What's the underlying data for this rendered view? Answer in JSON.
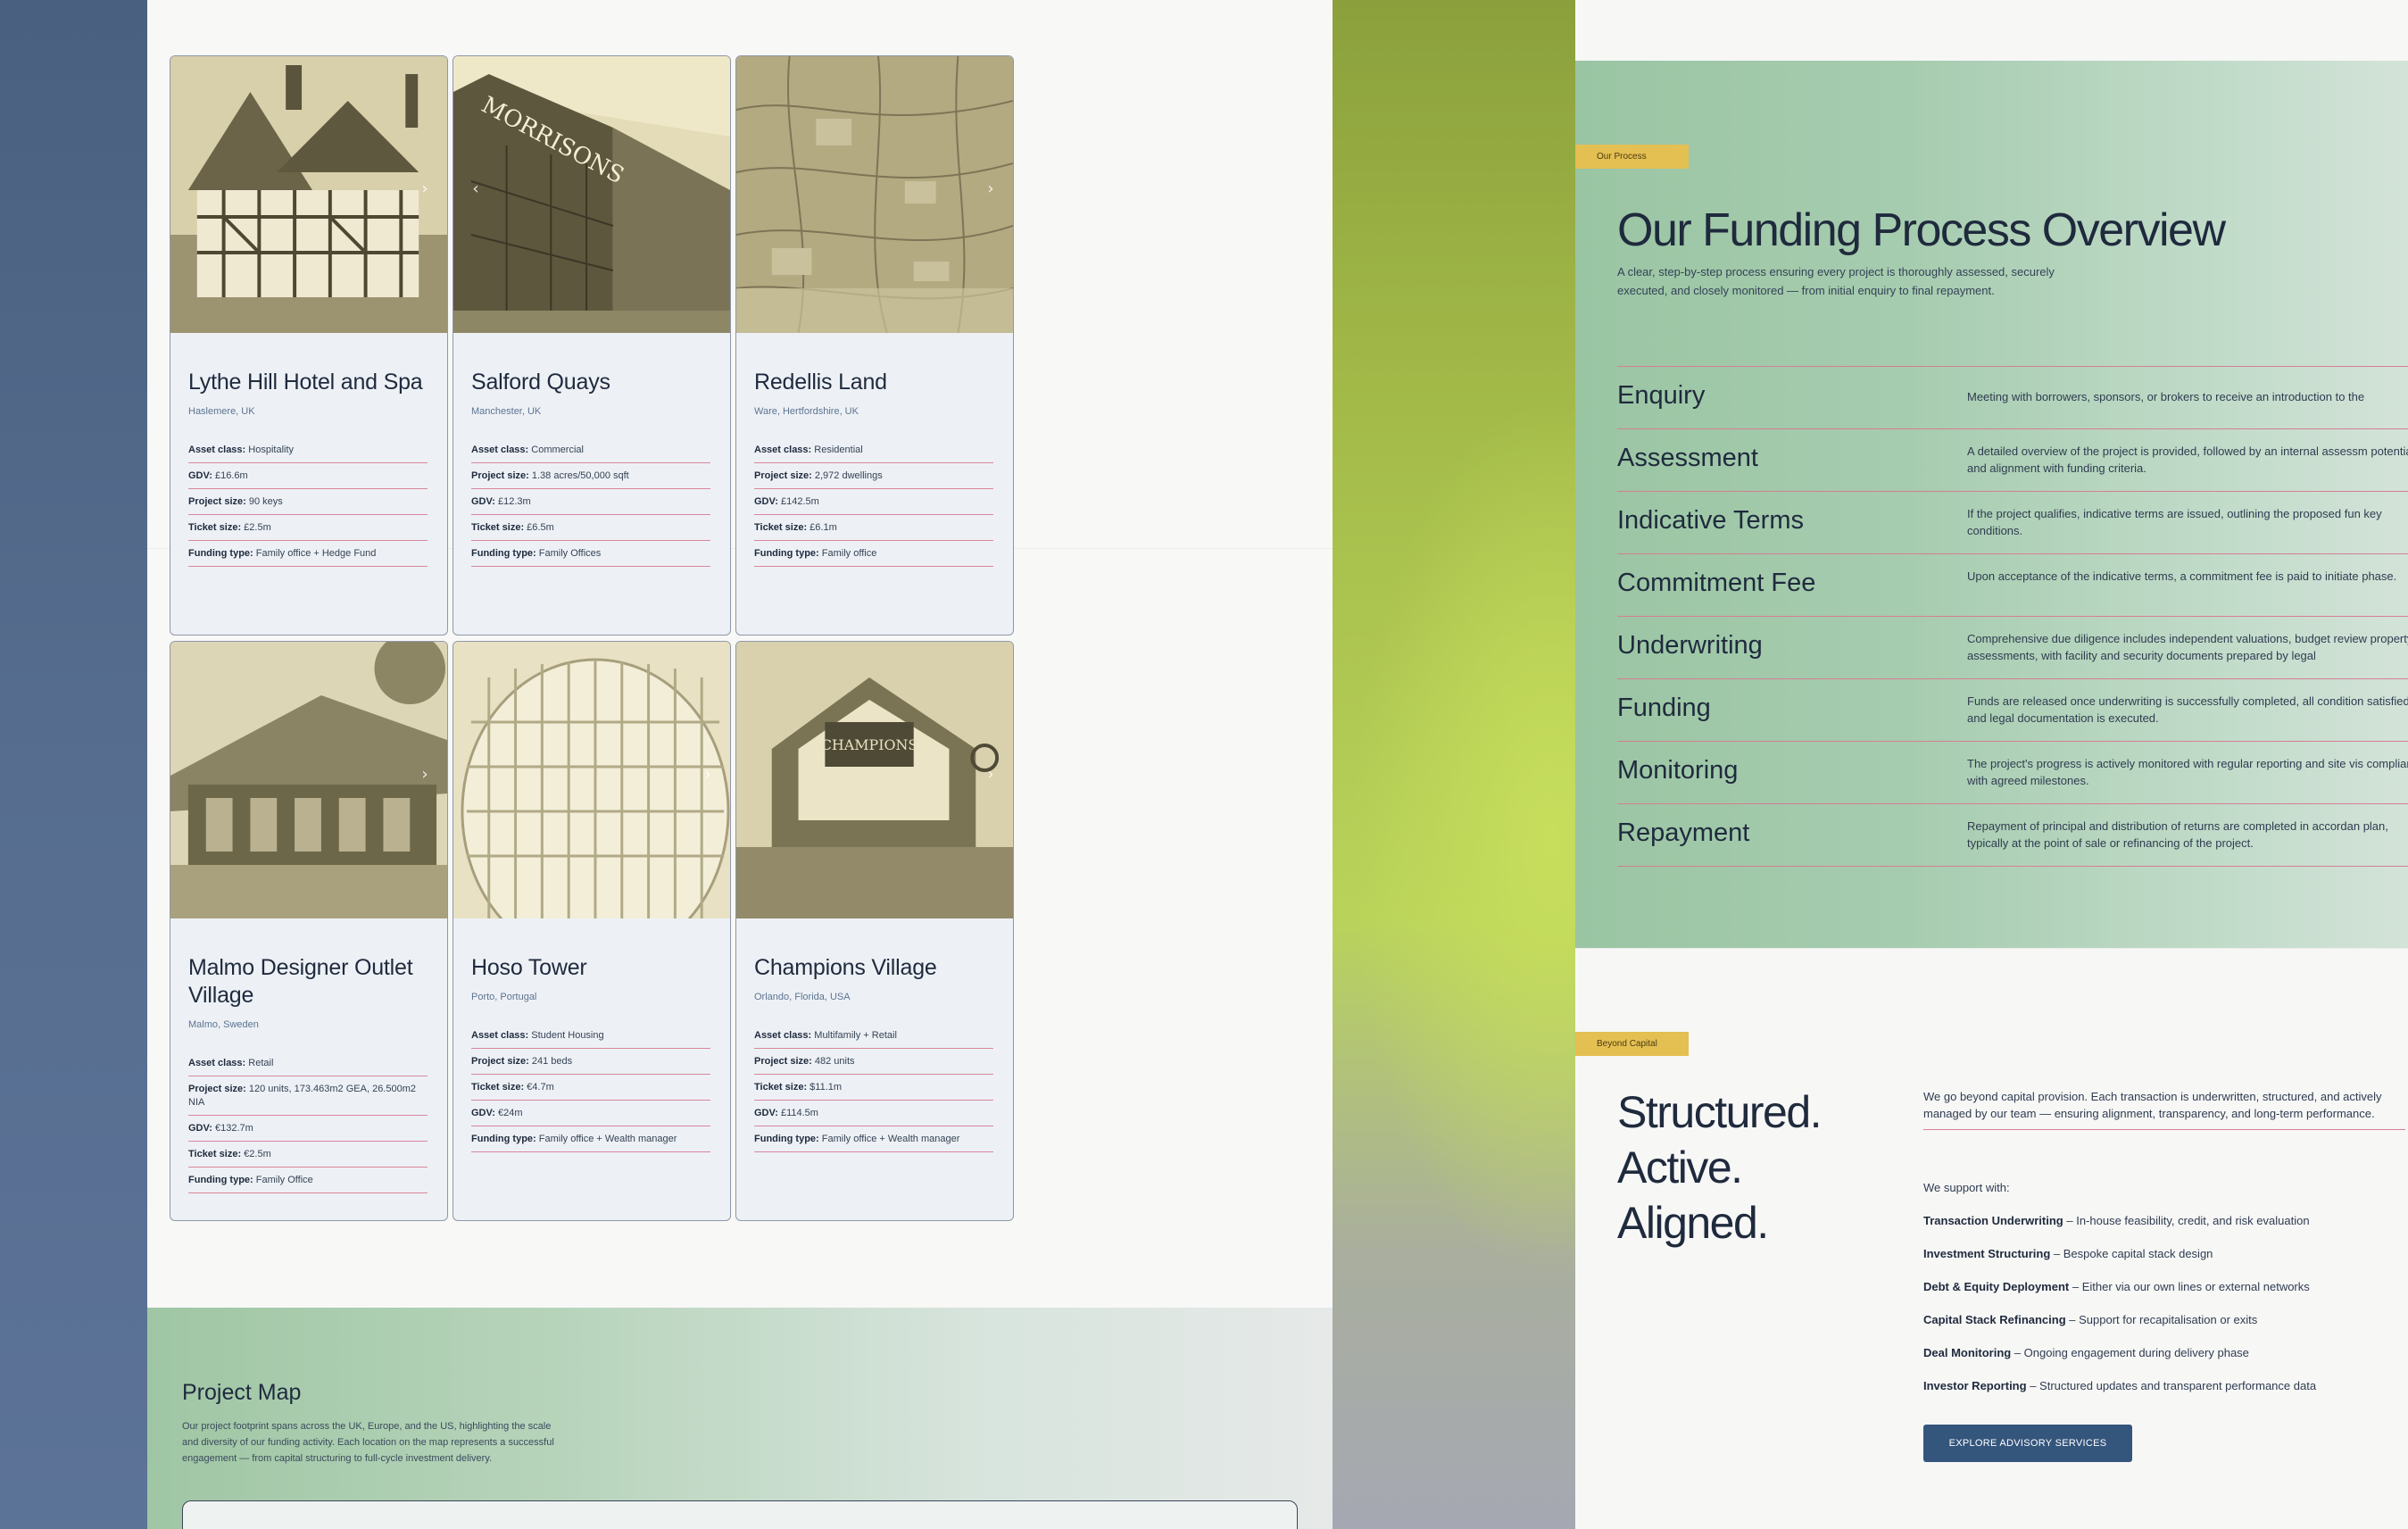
{
  "projects": [
    {
      "title": "Lythe Hill Hotel and Spa",
      "location": "Haslemere, UK",
      "specs": [
        {
          "label": "Asset class:",
          "value": "Hospitality"
        },
        {
          "label": "GDV:",
          "value": "£16.6m"
        },
        {
          "label": "Project size:",
          "value": "90 keys"
        },
        {
          "label": "Ticket size:",
          "value": "£2.5m"
        },
        {
          "label": "Funding type:",
          "value": "Family office + Hedge Fund"
        }
      ]
    },
    {
      "title": "Salford Quays",
      "location": "Manchester, UK",
      "specs": [
        {
          "label": "Asset class:",
          "value": "Commercial"
        },
        {
          "label": "Project size:",
          "value": "1.38 acres/50,000 sqft"
        },
        {
          "label": "GDV:",
          "value": "£12.3m"
        },
        {
          "label": "Ticket size:",
          "value": "£6.5m"
        },
        {
          "label": "Funding type:",
          "value": "Family Offices"
        }
      ]
    },
    {
      "title": "Redellis Land",
      "location": "Ware, Hertfordshire, UK",
      "specs": [
        {
          "label": "Asset class:",
          "value": "Residential"
        },
        {
          "label": "Project size:",
          "value": "2,972 dwellings"
        },
        {
          "label": "GDV:",
          "value": "£142.5m"
        },
        {
          "label": "Ticket size:",
          "value": "£6.1m"
        },
        {
          "label": "Funding type:",
          "value": "Family office"
        }
      ]
    },
    {
      "title": "Malmo Designer Outlet Village",
      "location": "Malmo, Sweden",
      "specs": [
        {
          "label": "Asset class:",
          "value": "Retail"
        },
        {
          "label": "Project size:",
          "value": "120 units, 173.463m2 GEA, 26.500m2 NIA"
        },
        {
          "label": "GDV:",
          "value": "€132.7m"
        },
        {
          "label": "Ticket size:",
          "value": "€2.5m"
        },
        {
          "label": "Funding type:",
          "value": "Family Office"
        }
      ]
    },
    {
      "title": "Hoso Tower",
      "location": "Porto, Portugal",
      "specs": [
        {
          "label": "Asset class:",
          "value": "Student Housing"
        },
        {
          "label": "Project size:",
          "value": "241 beds"
        },
        {
          "label": "Ticket size:",
          "value": "€4.7m"
        },
        {
          "label": "GDV:",
          "value": "€24m"
        },
        {
          "label": "Funding type:",
          "value": "Family office + Wealth manager"
        }
      ]
    },
    {
      "title": "Champions Village",
      "location": "Orlando, Florida, USA",
      "specs": [
        {
          "label": "Asset class:",
          "value": "Multifamily + Retail"
        },
        {
          "label": "Project size:",
          "value": "482 units"
        },
        {
          "label": "Ticket size:",
          "value": "$11.1m"
        },
        {
          "label": "GDV:",
          "value": "£114.5m"
        },
        {
          "label": "Funding type:",
          "value": "Family office + Wealth manager"
        }
      ]
    }
  ],
  "map": {
    "title": "Project Map",
    "description": "Our project footprint spans across the UK, Europe, and the US, highlighting the scale and diversity of our funding activity. Each location on the map represents a successful engagement — from capital structuring to full-cycle investment delivery."
  },
  "process": {
    "tag": "Our Process",
    "title": "Our Funding Process Overview",
    "lead": "A clear, step-by-step process ensuring every project is thoroughly assessed, securely executed, and closely monitored — from initial enquiry to final repayment.",
    "steps": [
      {
        "name": "Enquiry",
        "desc": "Meeting with borrowers, sponsors, or brokers to receive an introduction to the"
      },
      {
        "name": "Assessment",
        "desc": "A detailed overview of the project is provided, followed by an internal assessm potential and alignment with funding criteria."
      },
      {
        "name": "Indicative Terms",
        "desc": "If the project qualifies, indicative terms are issued, outlining the proposed fun key conditions."
      },
      {
        "name": "Commitment Fee",
        "desc": "Upon acceptance of the indicative terms, a commitment fee is paid to initiate phase."
      },
      {
        "name": "Underwriting",
        "desc": "Comprehensive due diligence includes independent valuations, budget review property assessments, with facility and security documents prepared by legal"
      },
      {
        "name": "Funding",
        "desc": "Funds are released once underwriting is successfully completed, all condition satisfied, and legal documentation is executed."
      },
      {
        "name": "Monitoring",
        "desc": "The project's progress is actively monitored with regular reporting and site vis compliance with agreed milestones."
      },
      {
        "name": "Repayment",
        "desc": "Repayment of principal and distribution of returns are completed in accordan plan, typically at the point of sale or refinancing of the project."
      }
    ]
  },
  "beyond": {
    "tag": "Beyond Capital",
    "heading_lines": [
      "Structured.",
      "Active.",
      "Aligned."
    ],
    "lead": "We go beyond capital provision. Each transaction is underwritten, structured, and actively managed by our team — ensuring alignment, transparency, and long-term performance.",
    "support_label": "We support with:",
    "items": [
      {
        "label": "Transaction Underwriting",
        "text": " – In-house feasibility, credit, and risk evaluation"
      },
      {
        "label": "Investment Structuring",
        "text": " – Bespoke capital stack design"
      },
      {
        "label": "Debt & Equity Deployment",
        "text": " – Either via our own lines or external networks"
      },
      {
        "label": "Capital Stack Refinancing",
        "text": " – Support for recapitalisation or exits"
      },
      {
        "label": "Deal Monitoring",
        "text": " – Ongoing engagement during delivery phase"
      },
      {
        "label": "Investor Reporting",
        "text": " – Structured updates and transparent performance data"
      }
    ],
    "cta": "EXPLORE ADVISORY SERVICES"
  },
  "colors": {
    "accent_rule": "#d57f93",
    "tag_yellow": "#e4bf52",
    "navy_button": "#34557c",
    "green_band": "#9ac5a3"
  },
  "icons": [
    "chevron-left-icon",
    "chevron-right-icon"
  ]
}
